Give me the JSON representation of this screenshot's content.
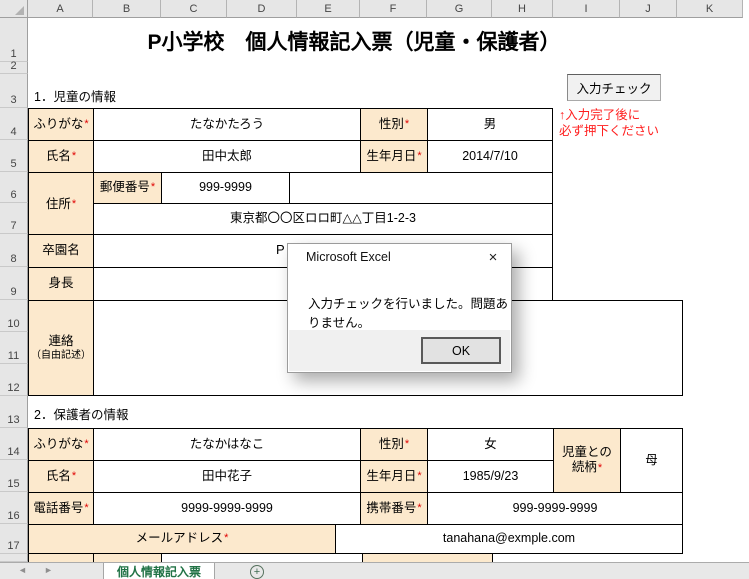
{
  "colors": {
    "label_fill": "#fce9cd",
    "active_tab_green": "#217346",
    "note_red": "#ff1f1f",
    "header_gray": "#e6e6e6"
  },
  "columns": [
    "A",
    "B",
    "C",
    "D",
    "E",
    "F",
    "G",
    "H",
    "I",
    "J",
    "K"
  ],
  "rows": [
    "1",
    "2",
    "3",
    "4",
    "5",
    "6",
    "7",
    "8",
    "9",
    "10",
    "11",
    "12",
    "13",
    "14",
    "15",
    "16",
    "17"
  ],
  "title": "P小学校　個人情報記入票（児童・保護者）",
  "required_mark": "*",
  "checker": {
    "button_label": "入力チェック",
    "note_line1": "↑入力完了後に",
    "note_line2": "必ず押下ください"
  },
  "section1": {
    "heading": "1．児童の情報",
    "furigana_label": "ふりがな",
    "furigana_value": "たなかたろう",
    "sex_label": "性別",
    "sex_value": "男",
    "name_label": "氏名",
    "name_value": "田中太郎",
    "birth_label": "生年月日",
    "birth_value": "2014/7/10",
    "address_label": "住所",
    "postal_label": "郵便番号",
    "postal_value": "999-9999",
    "address_value": "東京都〇〇区ロロ町△△丁目1-2-3",
    "kindergarten_label": "卒園名",
    "kindergarten_value_visible": "P",
    "height_label": "身長",
    "contact_label": "連絡",
    "contact_sublabel": "（自由記述）"
  },
  "section2": {
    "heading": "2．保護者の情報",
    "furigana_label": "ふりがな",
    "furigana_value": "たなかはなこ",
    "sex_label": "性別",
    "sex_value": "女",
    "relation_label_line1": "児童との",
    "relation_label_line2": "続柄",
    "relation_value": "母",
    "name_label": "氏名",
    "name_value": "田中花子",
    "birth_label": "生年月日",
    "birth_value": "1985/9/23",
    "phone_label": "電話番号",
    "phone_value": "9999-9999-9999",
    "mobile_label": "携帯番号",
    "mobile_value": "999-9999-9999",
    "email_label": "メールアドレス",
    "email_value": "tanahana@exmple.com"
  },
  "dialog": {
    "title": "Microsoft Excel",
    "close_icon": "×",
    "message": "入力チェックを行いました。問題ありません。",
    "ok_label": "OK"
  },
  "tabs": {
    "active_sheet": "個人情報記入票",
    "add_icon": "+",
    "nav_left_icon": "◄",
    "nav_right_icon": "►"
  }
}
